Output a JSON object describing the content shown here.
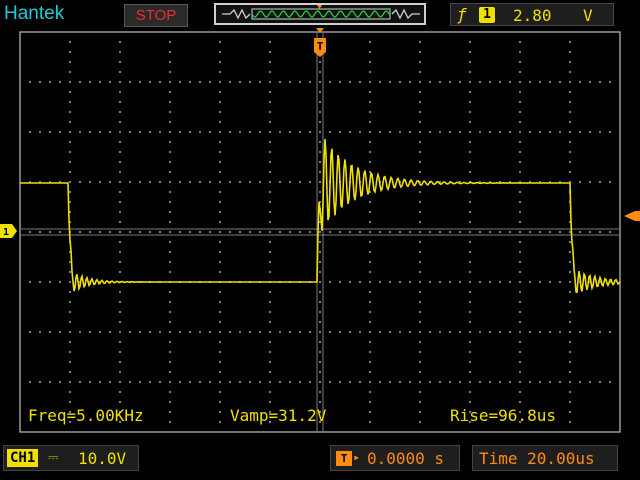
{
  "header": {
    "brand": "Hantek",
    "run_state": "STOP",
    "trigger": {
      "slope_glyph": "ƒ",
      "source": "1",
      "level": "2.80",
      "unit": "V"
    }
  },
  "markers": {
    "trigger_position_glyph": "T",
    "channel_ground_glyph": "1"
  },
  "measurements": {
    "freq": "Freq=5.00KHz",
    "vamp": "Vamp=31.2V",
    "rise": "Rise=96.8us"
  },
  "status": {
    "channel_label": "CH1",
    "coupling_glyph": "⎓",
    "volts_per_div": "10.0V",
    "trigger_pos_icon": "T",
    "trigger_pos_arrow": "▸",
    "trigger_position": "0.0000 s",
    "timebase": "Time 20.00us"
  },
  "colors": {
    "trace": "#f0e000",
    "grid": "#808080",
    "trigger_marker": "#ff8c10",
    "brand": "#22c8d8",
    "stop": "#e83030"
  },
  "icons": [
    "trigger-slope-icon",
    "minimap-icon",
    "trigger-marker-icon",
    "channel-ground-marker-icon",
    "trigger-level-marker-icon",
    "coupling-icon"
  ]
}
